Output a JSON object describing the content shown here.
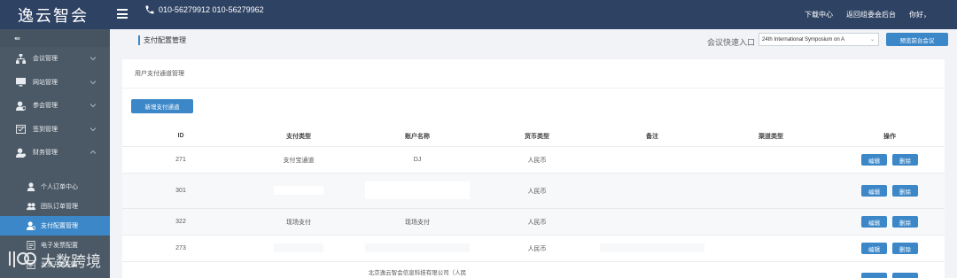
{
  "header": {
    "logo": "逸云智会",
    "phone": "010-56279912  010-56279962",
    "download": "下载中心",
    "back_admin": "返回组委会后台",
    "greeting": "你好，"
  },
  "sidebar": {
    "collapse_label": "⇚",
    "items": [
      {
        "label": "会议管理",
        "icon": "sitemap-icon"
      },
      {
        "label": "网站管理",
        "icon": "monitor-icon"
      },
      {
        "label": "参会管理",
        "icon": "user-gear-icon"
      },
      {
        "label": "签到管理",
        "icon": "calendar-check-icon"
      },
      {
        "label": "财务管理",
        "icon": "user-money-icon"
      }
    ],
    "finance_sub": [
      {
        "label": "个人订单中心",
        "icon": "user-icon"
      },
      {
        "label": "团队订单管理",
        "icon": "users-icon"
      },
      {
        "label": "支付配置管理",
        "icon": "money-user-icon",
        "active": true
      },
      {
        "label": "电子发票配置",
        "icon": "invoice-icon"
      },
      {
        "label": "发票开票配置",
        "icon": "invoice-icon"
      }
    ]
  },
  "page": {
    "breadcrumb": "支付配置管理",
    "quick_entry_label": "会议快速入口",
    "quick_entry_value": "24th International Symposium on A",
    "preview_button": "预览前台会议",
    "panel_title": "用户支付通道管理",
    "add_button": "新增支付通道"
  },
  "table": {
    "headers": [
      "ID",
      "支付类型",
      "账户名称",
      "货币类型",
      "备注",
      "渠道类型",
      "操作"
    ],
    "rows": [
      {
        "id": "271",
        "type": "支付宝通道",
        "account": "DJ",
        "currency": "人民币",
        "note": "",
        "channel": ""
      },
      {
        "id": "301",
        "type": "",
        "account": "",
        "currency": "人民币",
        "note": "",
        "channel": ""
      },
      {
        "id": "322",
        "type": "现场支付",
        "account": "现场支付",
        "currency": "人民币",
        "note": "",
        "channel": ""
      },
      {
        "id": "273",
        "type": "",
        "account": "",
        "currency": "人民币",
        "note": "",
        "channel": ""
      },
      {
        "id": "",
        "type": "",
        "account": "北京逸云智会信息科技有限公司（人民",
        "currency": "",
        "note": "",
        "channel": ""
      }
    ],
    "edit_label": "编辑",
    "delete_label": "删除"
  },
  "watermark": "大数跨境"
}
